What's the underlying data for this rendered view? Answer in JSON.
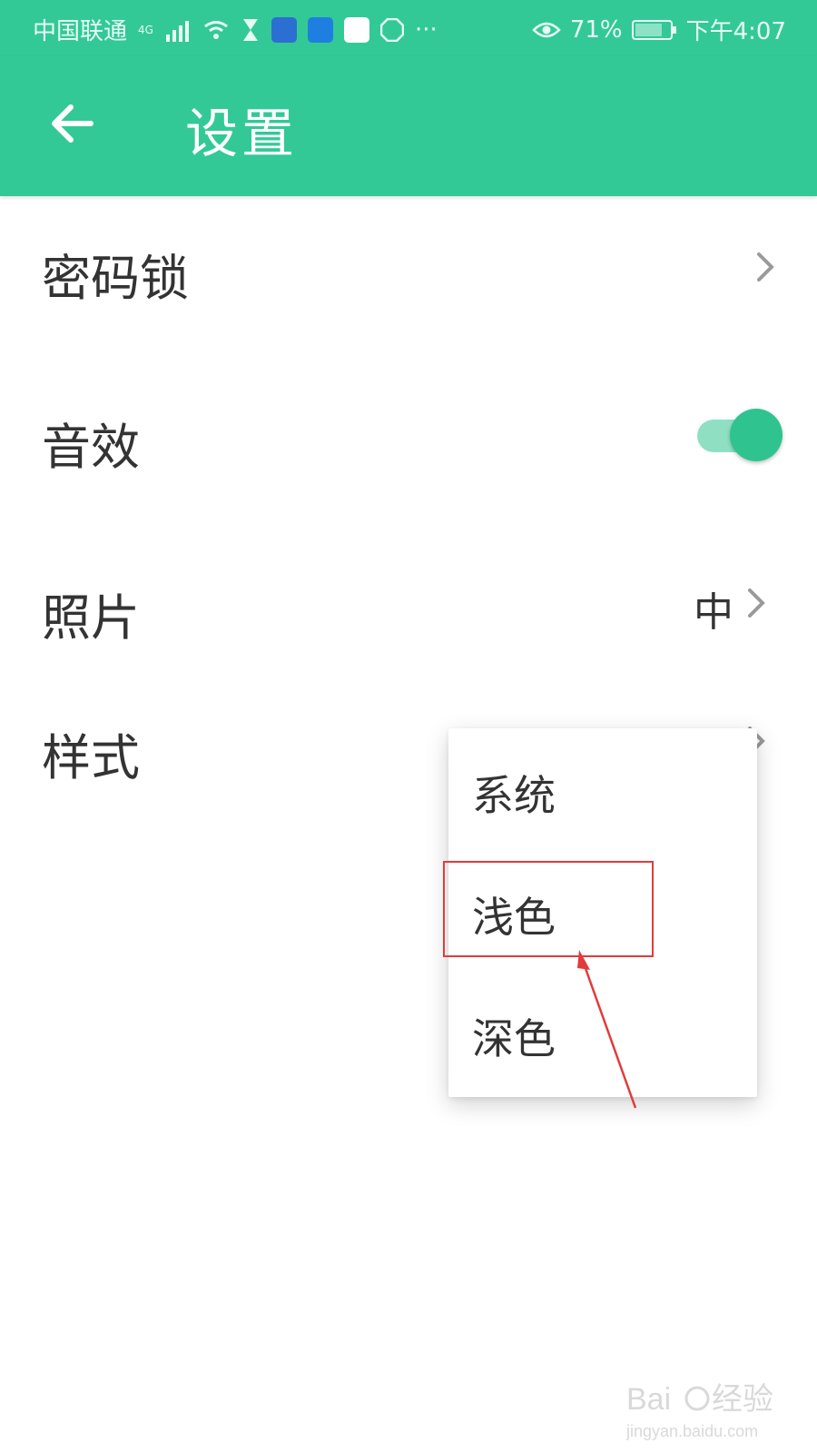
{
  "status_bar": {
    "carrier": "中国联通",
    "network": "4G",
    "battery_percent": "71%",
    "time": "下午4:07",
    "more": "···"
  },
  "app_bar": {
    "title": "设置",
    "background_color": "#33c997"
  },
  "settings": {
    "items": [
      {
        "label": "密码锁",
        "value": "",
        "icon": "chevron-right-icon"
      },
      {
        "label": "音效",
        "toggle_on": true
      },
      {
        "label": "照片",
        "value": "中",
        "icon": "chevron-right-icon"
      },
      {
        "label": "样式",
        "icon": "chevron-right-icon"
      }
    ]
  },
  "style_menu": {
    "options": [
      "系统",
      "浅色",
      "深色"
    ],
    "highlighted": "浅色"
  },
  "annotation": {
    "color": "#e23b3b"
  }
}
